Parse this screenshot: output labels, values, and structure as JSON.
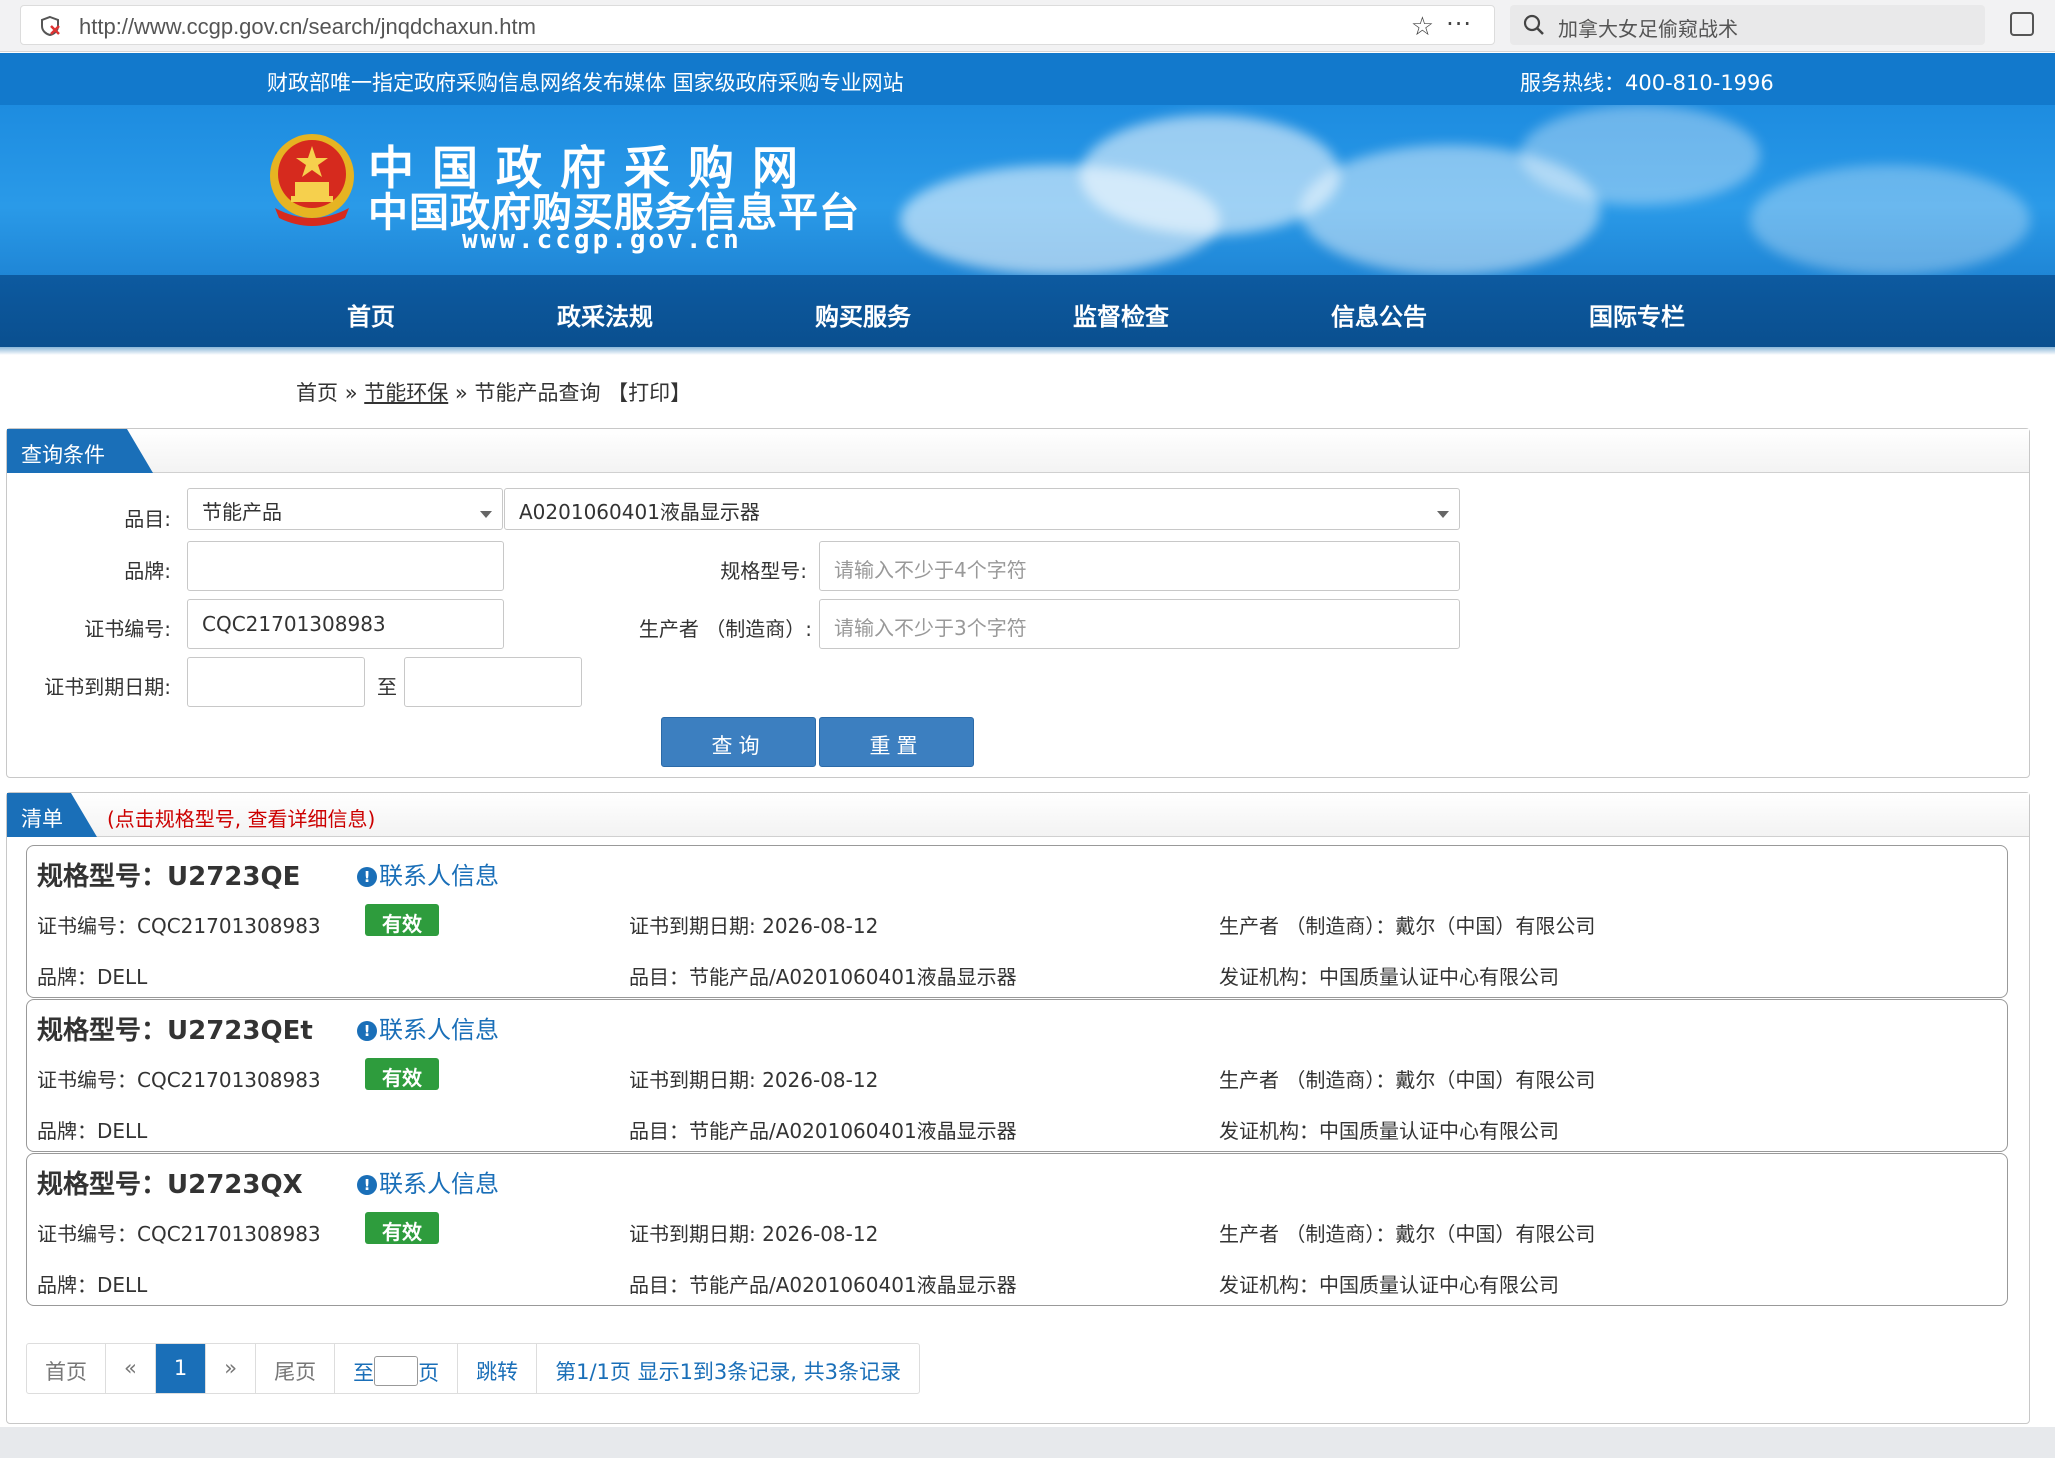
{
  "browser": {
    "url": "http://www.ccgp.gov.cn/search/jnqdchaxun.htm",
    "search_placeholder": "加拿大女足偷窥战术"
  },
  "header": {
    "slogan": "财政部唯一指定政府采购信息网络发布媒体 国家级政府采购专业网站",
    "hotline": "服务热线：400-810-1996",
    "logo_line1": "中国政府采购网",
    "logo_line2": "中国政府购买服务信息平台",
    "logo_url": "www.ccgp.gov.cn"
  },
  "nav": {
    "items": [
      "首页",
      "政采法规",
      "购买服务",
      "监督检查",
      "信息公告",
      "国际专栏"
    ]
  },
  "breadcrumb": {
    "home": "首页",
    "sep": "»",
    "section": "节能环保",
    "current": "节能产品查询",
    "print": "【打印】"
  },
  "query": {
    "title": "查询条件",
    "category_label": "品目:",
    "category_value": "节能产品",
    "subcategory_value": "A0201060401液晶显示器",
    "brand_label": "品牌:",
    "brand_value": "",
    "model_label": "规格型号:",
    "model_placeholder": "请输入不少于4个字符",
    "cert_label": "证书编号:",
    "cert_value": "CQC21701308983",
    "maker_label": "生产者 （制造商）:",
    "maker_placeholder": "请输入不少于3个字符",
    "expiry_label": "证书到期日期:",
    "expiry_to": "至",
    "search_button": "查询",
    "reset_button": "重置"
  },
  "results": {
    "title": "清单",
    "note": "(点击规格型号, 查看详细信息)",
    "contact_label": "联系人信息",
    "items": [
      {
        "model": "规格型号：U2723QE",
        "cert": "证书编号：CQC21701308983",
        "status": "有效",
        "expiry": "证书到期日期: 2026-08-12",
        "maker": "生产者 （制造商）：戴尔（中国）有限公司",
        "brand": "品牌：DELL",
        "category": "品目：节能产品/A0201060401液晶显示器",
        "issuer": "发证机构：中国质量认证中心有限公司"
      },
      {
        "model": "规格型号：U2723QEt",
        "cert": "证书编号：CQC21701308983",
        "status": "有效",
        "expiry": "证书到期日期: 2026-08-12",
        "maker": "生产者 （制造商）：戴尔（中国）有限公司",
        "brand": "品牌：DELL",
        "category": "品目：节能产品/A0201060401液晶显示器",
        "issuer": "发证机构：中国质量认证中心有限公司"
      },
      {
        "model": "规格型号：U2723QX",
        "cert": "证书编号：CQC21701308983",
        "status": "有效",
        "expiry": "证书到期日期: 2026-08-12",
        "maker": "生产者 （制造商）：戴尔（中国）有限公司",
        "brand": "品牌：DELL",
        "category": "品目：节能产品/A0201060401液晶显示器",
        "issuer": "发证机构：中国质量认证中心有限公司"
      }
    ]
  },
  "pager": {
    "first": "首页",
    "prev": "«",
    "current": "1",
    "next": "»",
    "last": "尾页",
    "goto_prefix": "至",
    "goto_suffix": "页",
    "jump": "跳转",
    "summary": "第1/1页  显示1到3条记录, 共3条记录"
  },
  "colors": {
    "brand_blue": "#1279cc",
    "nav_blue": "#0a4f8f",
    "valid_green": "#2e9c3d",
    "note_red": "#cc0000"
  }
}
